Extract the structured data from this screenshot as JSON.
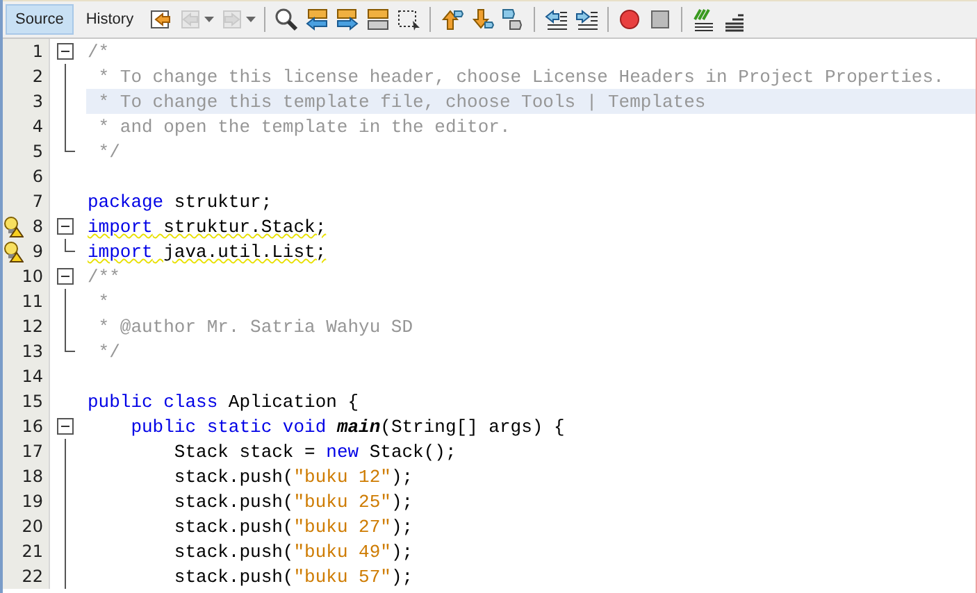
{
  "tabs": [
    {
      "label": "Source",
      "selected": true
    },
    {
      "label": "History",
      "selected": false
    }
  ],
  "toolbar": [
    {
      "kind": "last-edit",
      "disabled": false
    },
    {
      "kind": "back",
      "disabled": true
    },
    {
      "kind": "forward",
      "disabled": true
    },
    {
      "kind": "sep"
    },
    {
      "kind": "find",
      "disabled": false
    },
    {
      "kind": "find-prev",
      "disabled": false
    },
    {
      "kind": "find-next",
      "disabled": false
    },
    {
      "kind": "highlight",
      "disabled": false
    },
    {
      "kind": "select",
      "disabled": false
    },
    {
      "kind": "sep"
    },
    {
      "kind": "bookmark-prev",
      "disabled": false
    },
    {
      "kind": "bookmark-next",
      "disabled": false
    },
    {
      "kind": "bookmark",
      "disabled": false
    },
    {
      "kind": "sep"
    },
    {
      "kind": "shift-left",
      "disabled": false
    },
    {
      "kind": "shift-right",
      "disabled": false
    },
    {
      "kind": "sep"
    },
    {
      "kind": "record",
      "disabled": false
    },
    {
      "kind": "stop",
      "disabled": false
    },
    {
      "kind": "sep"
    },
    {
      "kind": "comment",
      "disabled": false
    },
    {
      "kind": "uncomment",
      "disabled": false
    }
  ],
  "lines": [
    {
      "number": "1",
      "fold_open": true,
      "fold_end": false,
      "highlighted": false,
      "hint": false,
      "tokens": [
        {
          "kind": "comment",
          "text": "/*"
        }
      ]
    },
    {
      "number": "2",
      "fold_open": false,
      "fold_end": false,
      "highlighted": false,
      "hint": false,
      "tokens": [
        {
          "kind": "comment",
          "text": " * To change this license header, choose License Headers in Project Properties."
        }
      ]
    },
    {
      "number": "3",
      "fold_open": false,
      "fold_end": false,
      "highlighted": true,
      "hint": false,
      "tokens": [
        {
          "kind": "comment",
          "text": " * To change this template file, choose Tools | Templates"
        }
      ]
    },
    {
      "number": "4",
      "fold_open": false,
      "fold_end": false,
      "highlighted": false,
      "hint": false,
      "tokens": [
        {
          "kind": "comment",
          "text": " * and open the template in the editor."
        }
      ]
    },
    {
      "number": "5",
      "fold_open": false,
      "fold_end": true,
      "highlighted": false,
      "hint": false,
      "tokens": [
        {
          "kind": "comment",
          "text": " */"
        }
      ]
    },
    {
      "number": "6",
      "fold_open": false,
      "fold_end": false,
      "highlighted": false,
      "hint": false
    },
    {
      "number": "7",
      "fold_open": false,
      "fold_end": false,
      "highlighted": false,
      "hint": false,
      "tokens": [
        {
          "kind": "keyword",
          "text": "package"
        },
        {
          "kind": "plain",
          "text": " struktur;"
        }
      ]
    },
    {
      "number": "8",
      "fold_open": true,
      "fold_end": false,
      "highlighted": false,
      "hint": true,
      "tokens": [
        {
          "kind": "keyword",
          "text": "import"
        },
        {
          "kind": "plain",
          "text": " struktur.Stack;"
        }
      ]
    },
    {
      "number": "9",
      "fold_open": false,
      "fold_end": true,
      "highlighted": false,
      "hint": true,
      "tokens": [
        {
          "kind": "keyword",
          "text": "import"
        },
        {
          "kind": "plain",
          "text": " java.util.List;"
        }
      ]
    },
    {
      "number": "10",
      "fold_open": true,
      "fold_end": false,
      "highlighted": false,
      "hint": false,
      "tokens": [
        {
          "kind": "comment",
          "text": "/**"
        }
      ]
    },
    {
      "number": "11",
      "fold_open": false,
      "fold_end": false,
      "highlighted": false,
      "hint": false,
      "tokens": [
        {
          "kind": "comment",
          "text": " *"
        }
      ]
    },
    {
      "number": "12",
      "fold_open": false,
      "fold_end": false,
      "highlighted": false,
      "hint": false,
      "tokens": [
        {
          "kind": "comment",
          "text": " * @author Mr. Satria Wahyu SD"
        }
      ]
    },
    {
      "number": "13",
      "fold_open": false,
      "fold_end": true,
      "highlighted": false,
      "hint": false,
      "tokens": [
        {
          "kind": "comment",
          "text": " */"
        }
      ]
    },
    {
      "number": "14",
      "fold_open": false,
      "fold_end": false,
      "highlighted": false,
      "hint": false
    },
    {
      "number": "15",
      "fold_open": false,
      "fold_end": false,
      "highlighted": false,
      "hint": false,
      "tokens": [
        {
          "kind": "keyword",
          "text": "public class"
        },
        {
          "kind": "plain",
          "text": " Aplication {"
        }
      ]
    },
    {
      "number": "16",
      "fold_open": true,
      "fold_end": false,
      "highlighted": false,
      "hint": false,
      "tokens": [
        {
          "kind": "keyword",
          "text": "    public static void"
        },
        {
          "kind": "method",
          "text": " main"
        },
        {
          "kind": "plain",
          "text": "(String[] args) {"
        }
      ]
    },
    {
      "number": "17",
      "fold_open": false,
      "fold_end": false,
      "highlighted": false,
      "hint": false,
      "tokens": [
        {
          "kind": "plain",
          "text": "        Stack stack = "
        },
        {
          "kind": "keyword",
          "text": "new"
        },
        {
          "kind": "plain",
          "text": " Stack();"
        }
      ]
    },
    {
      "number": "18",
      "fold_open": false,
      "fold_end": false,
      "highlighted": false,
      "hint": false,
      "tokens": [
        {
          "kind": "plain",
          "text": "        stack.push("
        },
        {
          "kind": "string",
          "text": "\"buku 12\""
        },
        {
          "kind": "plain",
          "text": ");"
        }
      ]
    },
    {
      "number": "19",
      "fold_open": false,
      "fold_end": false,
      "highlighted": false,
      "hint": false,
      "tokens": [
        {
          "kind": "plain",
          "text": "        stack.push("
        },
        {
          "kind": "string",
          "text": "\"buku 25\""
        },
        {
          "kind": "plain",
          "text": ");"
        }
      ]
    },
    {
      "number": "20",
      "fold_open": false,
      "fold_end": false,
      "highlighted": false,
      "hint": false,
      "tokens": [
        {
          "kind": "plain",
          "text": "        stack.push("
        },
        {
          "kind": "string",
          "text": "\"buku 27\""
        },
        {
          "kind": "plain",
          "text": ");"
        }
      ]
    },
    {
      "number": "21",
      "fold_open": false,
      "fold_end": false,
      "highlighted": false,
      "hint": false,
      "tokens": [
        {
          "kind": "plain",
          "text": "        stack.push("
        },
        {
          "kind": "string",
          "text": "\"buku 49\""
        },
        {
          "kind": "plain",
          "text": ");"
        }
      ]
    },
    {
      "number": "22",
      "fold_open": false,
      "fold_end": false,
      "highlighted": false,
      "hint": false,
      "tokens": [
        {
          "kind": "plain",
          "text": "        stack.push("
        },
        {
          "kind": "string",
          "text": "\"buku 57\""
        },
        {
          "kind": "plain",
          "text": ");"
        }
      ]
    }
  ]
}
